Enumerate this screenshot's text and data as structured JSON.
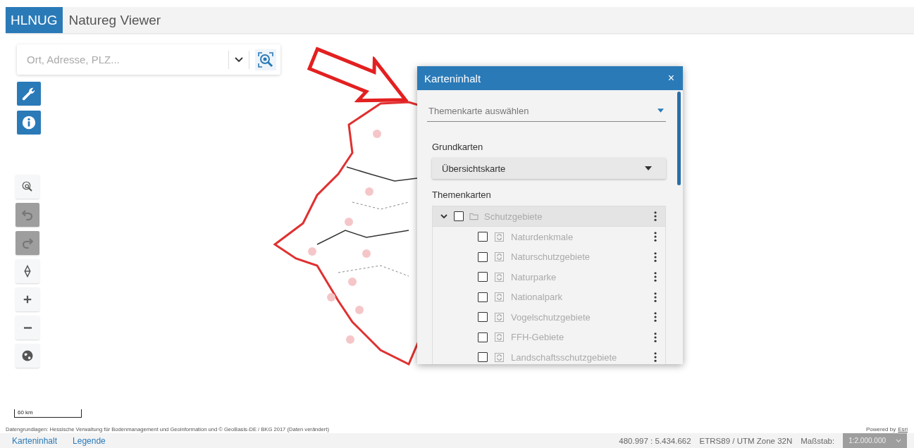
{
  "header": {
    "logo": "HLNUG",
    "title": "Natureg Viewer"
  },
  "search": {
    "placeholder": "Ort, Adresse, PLZ..."
  },
  "tool_buttons": [
    {
      "kind": "tools"
    },
    {
      "kind": "info"
    }
  ],
  "map_controls": [
    {
      "kind": "locate",
      "disabled": false
    },
    {
      "kind": "undo",
      "disabled": true
    },
    {
      "kind": "redo",
      "disabled": true
    },
    {
      "kind": "compass",
      "disabled": false
    },
    {
      "kind": "zoom-in",
      "disabled": false
    },
    {
      "kind": "zoom-out",
      "disabled": false
    },
    {
      "kind": "globe",
      "disabled": false
    }
  ],
  "panel": {
    "title": "Karteninhalt",
    "close": "×",
    "theme_select": {
      "placeholder": "Themenkarte auswählen"
    },
    "basemaps": {
      "label": "Grundkarten",
      "value": "Übersichtskarte"
    },
    "themes": {
      "label": "Themenkarten",
      "tree": [
        {
          "label": "Schutzgebiete",
          "expanded": true,
          "checked": false,
          "children": [
            {
              "label": "Naturdenkmale",
              "checked": false
            },
            {
              "label": "Naturschutzgebiete",
              "checked": false
            },
            {
              "label": "Naturparke",
              "checked": false
            },
            {
              "label": "Nationalpark",
              "checked": false
            },
            {
              "label": "Vogelschutzgebiete",
              "checked": false
            },
            {
              "label": "FFH-Gebiete",
              "checked": false
            },
            {
              "label": "Landschaftsschutzgebiete",
              "checked": false
            }
          ]
        }
      ]
    }
  },
  "scale_bar": "60 km",
  "attribution": "Datengrundlagen: Hessische Verwaltung für Bodenmanagement und Geoinformation und © GeoBasis-DE / BKG 2017 (Daten verändert)",
  "powered_by": {
    "text": "Powered by",
    "link": "Esri"
  },
  "footer": {
    "tabs": [
      "Karteninhalt",
      "Legende"
    ],
    "coordinates": "480.997 : 5.434.662",
    "crs": "ETRS89 / UTM Zone 32N",
    "scale_label": "Maßstab:",
    "scale_value": "1:2.000.000"
  }
}
